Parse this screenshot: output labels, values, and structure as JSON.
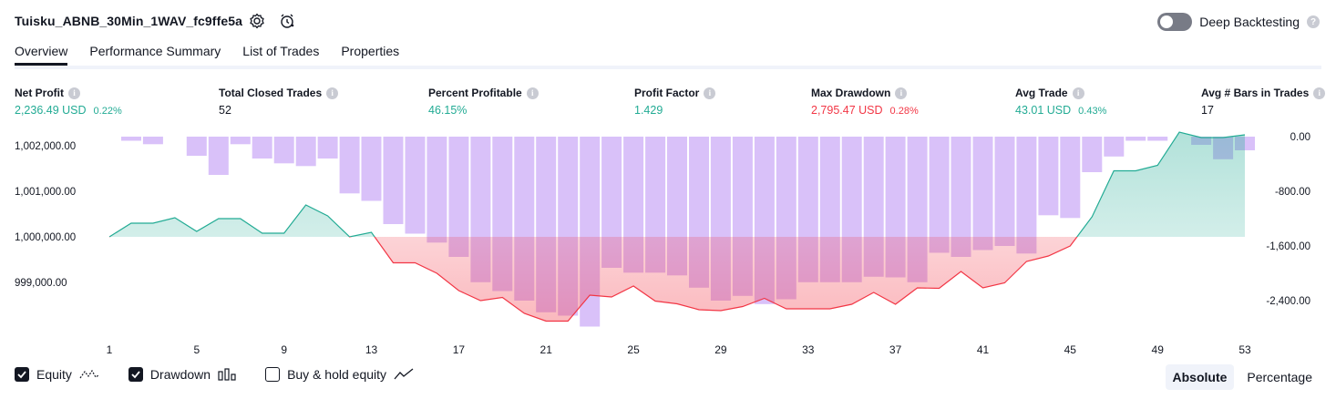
{
  "header": {
    "title": "Tuisku_ABNB_30Min_1WAV_fc9ffe5a",
    "deep_backtesting_label": "Deep Backtesting",
    "deep_backtesting_on": false,
    "help_mark": "?"
  },
  "tabs": [
    {
      "label": "Overview",
      "active": true
    },
    {
      "label": "Performance Summary",
      "active": false
    },
    {
      "label": "List of Trades",
      "active": false
    },
    {
      "label": "Properties",
      "active": false
    }
  ],
  "stats": {
    "net_profit": {
      "label": "Net Profit",
      "value": "2,236.49 USD",
      "pct": "0.22%"
    },
    "total_closed_trades": {
      "label": "Total Closed Trades",
      "value": "52"
    },
    "percent_profitable": {
      "label": "Percent Profitable",
      "value": "46.15%"
    },
    "profit_factor": {
      "label": "Profit Factor",
      "value": "1.429"
    },
    "max_drawdown": {
      "label": "Max Drawdown",
      "value": "2,795.47 USD",
      "pct": "0.28%"
    },
    "avg_trade": {
      "label": "Avg Trade",
      "value": "43.01 USD",
      "pct": "0.43%"
    },
    "avg_bars": {
      "label": "Avg # Bars in Trades",
      "value": "17"
    }
  },
  "colors": {
    "positive": "#22ab94",
    "negative": "#f23645",
    "drawdown_bar": "#c9a7f7",
    "equity_line_pos": "#22ab94",
    "equity_line_neg": "#f23645"
  },
  "chart_data": {
    "type": "line",
    "left_axis_ticks": [
      "1,002,000.00",
      "1,001,000.00",
      "1,000,000.00",
      "999,000.00"
    ],
    "right_axis_ticks": [
      "0.00",
      "-800.00",
      "-1,600.00",
      "-2,400.00"
    ],
    "x_ticks": [
      "1",
      "5",
      "9",
      "13",
      "17",
      "21",
      "25",
      "29",
      "33",
      "37",
      "41",
      "45",
      "49",
      "53"
    ],
    "baseline_equity": 1000000,
    "left_ylim": [
      998000,
      1002200
    ],
    "right_ylim": [
      -2800,
      0
    ],
    "series": [
      {
        "name": "Equity",
        "x": [
          1,
          2,
          3,
          4,
          5,
          6,
          7,
          8,
          9,
          10,
          11,
          12,
          13,
          14,
          15,
          16,
          17,
          18,
          19,
          20,
          21,
          22,
          23,
          24,
          25,
          26,
          27,
          28,
          29,
          30,
          31,
          32,
          33,
          34,
          35,
          36,
          37,
          38,
          39,
          40,
          41,
          42,
          43,
          44,
          45,
          46,
          47,
          48,
          49,
          50,
          51,
          52,
          53
        ],
        "values": [
          1000000,
          1000300,
          1000300,
          1000420,
          1000120,
          1000400,
          1000400,
          1000080,
          1000080,
          1000700,
          1000460,
          1000000,
          1000100,
          999430,
          999430,
          999200,
          998820,
          998600,
          998670,
          998320,
          998150,
          998150,
          998720,
          998680,
          998920,
          998590,
          998530,
          998400,
          998380,
          998470,
          998650,
          998420,
          998420,
          998420,
          998520,
          998780,
          998520,
          998880,
          998870,
          999240,
          998880,
          998990,
          999460,
          999580,
          999800,
          1000440,
          1001450,
          1001450,
          1001570,
          1002300,
          1002180,
          1002180,
          1002240
        ]
      },
      {
        "name": "Drawdown",
        "x": [
          1,
          2,
          3,
          4,
          5,
          6,
          7,
          8,
          9,
          10,
          11,
          12,
          13,
          14,
          15,
          16,
          17,
          18,
          19,
          20,
          21,
          22,
          23,
          24,
          25,
          26,
          27,
          28,
          29,
          30,
          31,
          32,
          33,
          34,
          35,
          36,
          37,
          38,
          39,
          40,
          41,
          42,
          43,
          44,
          45,
          46,
          47,
          48,
          49,
          50,
          51,
          52,
          53
        ],
        "values": [
          0,
          -60,
          -110,
          0,
          -280,
          -560,
          -110,
          -320,
          -390,
          -430,
          -320,
          -830,
          -940,
          -1280,
          -1420,
          -1550,
          -1760,
          -2130,
          -2260,
          -2400,
          -2570,
          -2620,
          -2780,
          -1920,
          -1990,
          -1990,
          -2030,
          -2210,
          -2400,
          -2330,
          -2450,
          -2380,
          -2130,
          -2130,
          -2130,
          -2050,
          -2060,
          -2130,
          -1700,
          -1760,
          -1660,
          -1600,
          -1710,
          -1150,
          -1190,
          -520,
          -290,
          -60,
          -60,
          0,
          -120,
          -330,
          -200
        ]
      }
    ]
  },
  "legend": {
    "equity": {
      "label": "Equity",
      "checked": true
    },
    "drawdown": {
      "label": "Drawdown",
      "checked": true
    },
    "buy_hold": {
      "label": "Buy & hold equity",
      "checked": false
    }
  },
  "modes": [
    {
      "label": "Absolute",
      "active": true
    },
    {
      "label": "Percentage",
      "active": false
    }
  ]
}
